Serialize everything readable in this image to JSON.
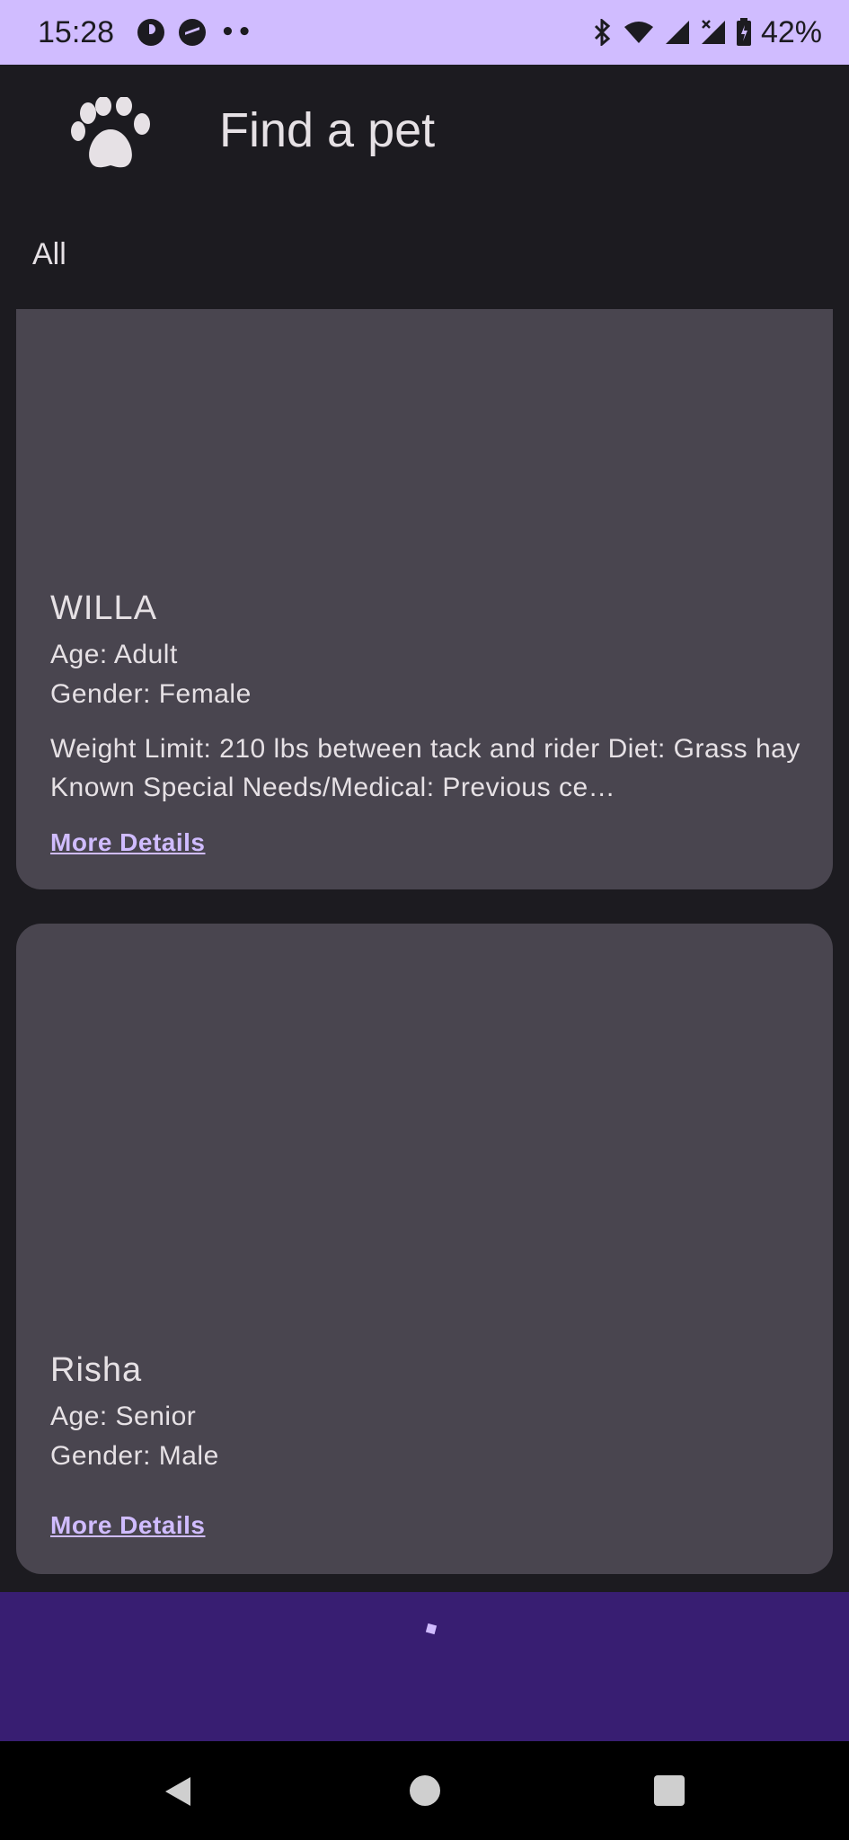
{
  "status_bar": {
    "time": "15:28",
    "dots": "••",
    "battery_percent": "42%",
    "icons": [
      "p-app-icon",
      "messenger-icon",
      "bluetooth-icon",
      "wifi-icon",
      "signal-icon",
      "signal-no-data-icon",
      "battery-icon"
    ]
  },
  "app_bar": {
    "icon": "paw-icon",
    "title": "Find a pet"
  },
  "filter": {
    "label": "All"
  },
  "pets": [
    {
      "name": "WILLA",
      "age": "Age: Adult",
      "gender": "Gender: Female",
      "description": "Weight Limit: 210 lbs between tack and rider Diet: Grass hay Known Special Needs/Medical: Previous ce…",
      "link": "More Details"
    },
    {
      "name": "Risha",
      "age": "Age: Senior",
      "gender": "Gender: Male",
      "description": "",
      "link": "More Details"
    }
  ],
  "nav_bar": {
    "icons": [
      "back-icon",
      "home-icon",
      "recents-icon"
    ]
  },
  "colors": {
    "status_bar_bg": "#d0bcff",
    "background": "#1c1b20",
    "card": "#49454f",
    "link": "#d0bcff",
    "bottom_bar": "#381e72"
  }
}
